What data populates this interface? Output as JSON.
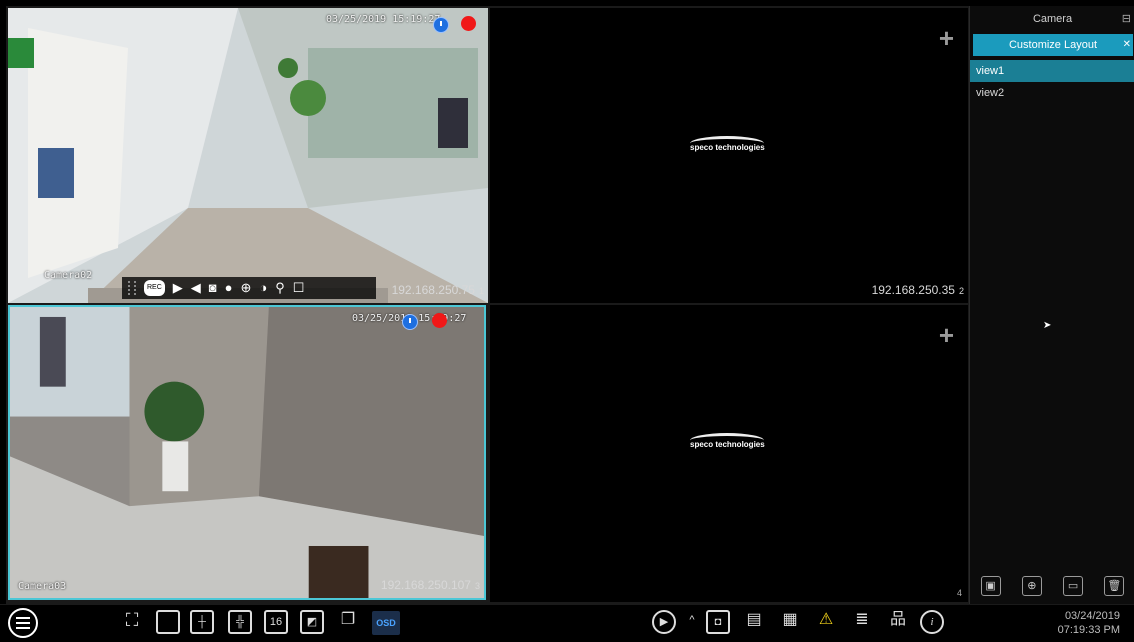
{
  "panes": [
    {
      "date": "03/25/2019 15:19:27",
      "camera": "Camera02",
      "ip": "192.168.250.75",
      "num": "1"
    },
    {
      "ip": "192.168.250.35",
      "num": "2",
      "logo": "speco technologies"
    },
    {
      "date": "03/25/2019 15:19:27",
      "camera": "Camera03",
      "ip": "192.168.250.107",
      "num": "3"
    },
    {
      "num": "4",
      "logo": "speco technologies"
    }
  ],
  "pane_toolbar": {
    "rec_label": "REC"
  },
  "side": {
    "title": "Camera",
    "customize_label": "Customize Layout",
    "views": [
      "view1",
      "view2"
    ]
  },
  "bottom": {
    "osd_label": "OSD",
    "layout16_label": "16",
    "date": "03/24/2019",
    "time": "07:19:33 PM"
  }
}
